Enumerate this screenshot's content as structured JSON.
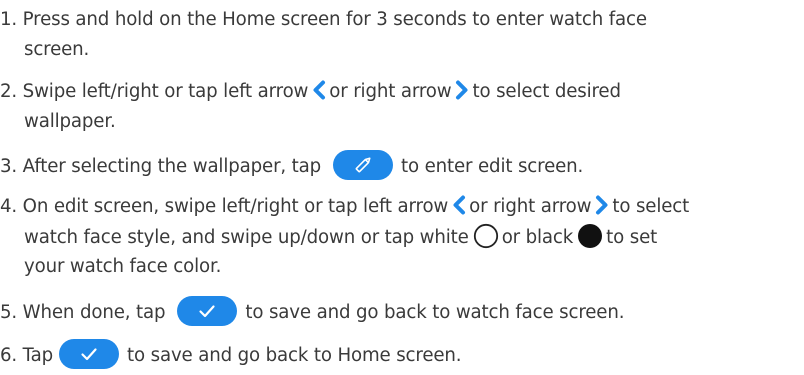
{
  "colors": {
    "text": "#3a3a3a",
    "accent": "#1f88e8"
  },
  "icons": {
    "left_arrow": "chevron-left-icon",
    "right_arrow": "chevron-right-icon",
    "edit": "pencil-icon",
    "confirm": "checkmark-icon",
    "white_color": "white-circle-icon",
    "black_color": "black-circle-icon"
  },
  "steps": [
    {
      "line1": "1. Press and hold on the Home screen for 3 seconds to enter watch face",
      "line2": "screen."
    },
    {
      "a": "2. Swipe left/right or tap left arrow",
      "b": "or right arrow",
      "c": "to select desired",
      "line2": "wallpaper."
    },
    {
      "a": "3. After selecting the wallpaper, tap",
      "b": "to enter edit screen."
    },
    {
      "a": "4. On edit screen, swipe left/right or tap left arrow",
      "b": "or right arrow",
      "c": "to select",
      "d": "watch face style, and swipe up/down or tap white",
      "e": "or black",
      "f": "to set",
      "line3": "your watch face color."
    },
    {
      "a": "5. When done, tap",
      "b": "to save and go back to watch face screen."
    },
    {
      "a": "6. Tap",
      "b": "to save and go back to Home screen."
    }
  ]
}
